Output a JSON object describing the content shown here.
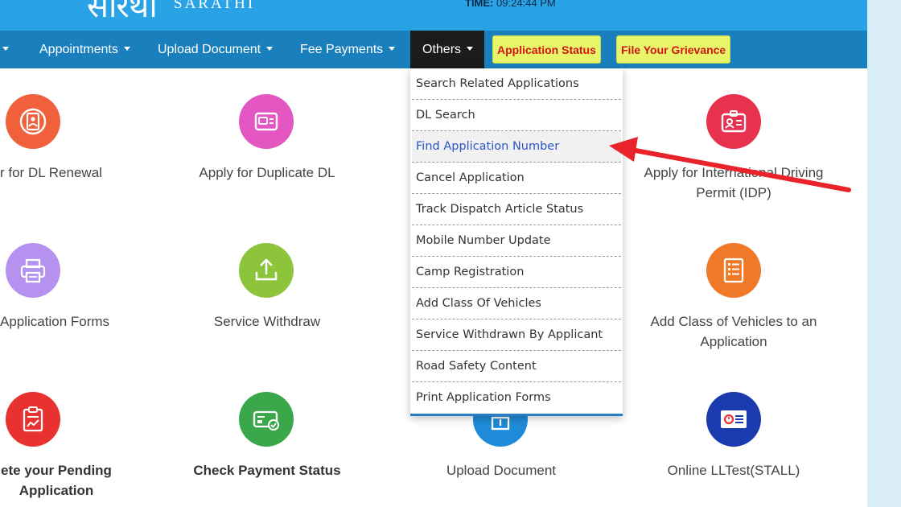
{
  "header": {
    "logo_text": "सारथी",
    "logo_sub": "SARATHI",
    "time_label": "TIME:",
    "time_value": "09:24:44 PM"
  },
  "nav": {
    "items": [
      {
        "label": "Appointments"
      },
      {
        "label": "Upload Document"
      },
      {
        "label": "Fee Payments"
      },
      {
        "label": "Others"
      }
    ],
    "application_status": "Application Status",
    "file_grievance": "File Your Grievance"
  },
  "others_menu": {
    "items": [
      {
        "label": "Search Related Applications"
      },
      {
        "label": "DL Search"
      },
      {
        "label": "Find Application Number"
      },
      {
        "label": "Cancel Application"
      },
      {
        "label": "Track Dispatch Article Status"
      },
      {
        "label": "Mobile Number Update"
      },
      {
        "label": "Camp Registration"
      },
      {
        "label": "Add Class Of Vehicles"
      },
      {
        "label": "Service Withdrawn By Applicant"
      },
      {
        "label": "Road Safety Content"
      },
      {
        "label": "Print Application Forms"
      }
    ],
    "highlighted": "Find Application Number"
  },
  "services": [
    {
      "label": "r for DL Renewal",
      "icon": "dl-renewal-icon",
      "color": "#f0603a"
    },
    {
      "label": "Apply for Duplicate DL",
      "icon": "duplicate-dl-icon",
      "color": "#e456c2"
    },
    {
      "label": "Apply for International Driving",
      "label2": "Permit (IDP)",
      "icon": "idp-icon",
      "color": "#e8304f"
    },
    {
      "label": "Application Forms",
      "icon": "printer-icon",
      "color": "#b692f0"
    },
    {
      "label": "Service Withdraw",
      "icon": "upload-tray-icon",
      "color": "#8cc43c"
    },
    {
      "label": "Add Class of Vehicles to an",
      "label2": "Application",
      "icon": "vehicle-class-form-icon",
      "color": "#f07a28"
    },
    {
      "label": "ete your Pending",
      "label2": "Application",
      "icon": "pending-clipboard-icon",
      "color": "#e8322f"
    },
    {
      "label": "Check Payment Status",
      "icon": "payment-status-icon",
      "color": "#3aa84a"
    },
    {
      "label": "Upload Document",
      "icon": "upload-document-icon",
      "color": "#1e8bd8"
    },
    {
      "label": "Online LLTest(STALL)",
      "icon": "lltest-icon",
      "color": "#1a3ab0"
    }
  ],
  "colors": {
    "header_bg": "#29a3e6",
    "nav_bg": "#1a80bd",
    "highlight_button_bg": "#e7f56b",
    "highlight_button_text": "#d21414",
    "annotation_arrow": "#e8242a"
  }
}
